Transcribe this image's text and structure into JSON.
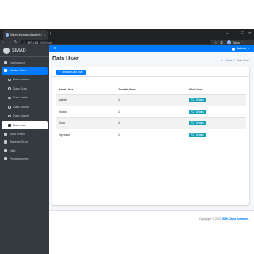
{
  "browser": {
    "tab_title": "Sistem Informasi Akademik Seko",
    "tab_close": "×",
    "new_tab": "+",
    "win_controls": [
      "⌄",
      "—",
      "☐",
      "✕"
    ],
    "url_host": "127.0.0.1",
    "url_path": ":8000/user",
    "profile_label": "Tamu"
  },
  "brand": {
    "name": "SIMAD"
  },
  "sidebar": {
    "items": [
      {
        "label": "Dashboard",
        "caret": ""
      },
      {
        "label": "Master Data",
        "caret": "‹"
      },
      {
        "label": "Data Jadwal",
        "caret": ""
      },
      {
        "label": "Data Guru",
        "caret": ""
      },
      {
        "label": "Data Kelas",
        "caret": ""
      },
      {
        "label": "Data Siswa",
        "caret": ""
      },
      {
        "label": "Data Mapel",
        "caret": ""
      },
      {
        "label": "Data User",
        "caret": ""
      },
      {
        "label": "View Trash",
        "caret": "‹"
      },
      {
        "label": "Absensi Guru",
        "caret": ""
      },
      {
        "label": "Nilai",
        "caret": "‹"
      },
      {
        "label": "Pengumuman",
        "caret": ""
      }
    ]
  },
  "topnav": {
    "menu_icon": "≡",
    "user_name": "Admin",
    "caret": "▾"
  },
  "header": {
    "title": "Data User",
    "breadcrumb_home": "Home",
    "breadcrumb_sep": "/",
    "breadcrumb_current": "Data User"
  },
  "card": {
    "add_button": "Tambah Data User",
    "add_icon": "+"
  },
  "table": {
    "headers": [
      "Level User",
      "Jumlah User",
      "Lihat User"
    ],
    "rows": [
      {
        "level": "Admin",
        "count": "1",
        "action": "Details"
      },
      {
        "level": "Siswa",
        "count": "1",
        "action": "Details"
      },
      {
        "level": "Guru",
        "count": "1",
        "action": "Details"
      },
      {
        "level": "Operator",
        "count": "1",
        "action": "Details"
      }
    ]
  },
  "footer": {
    "text": "Copyright © 2020",
    "brand": "SMK Jaya Software."
  }
}
